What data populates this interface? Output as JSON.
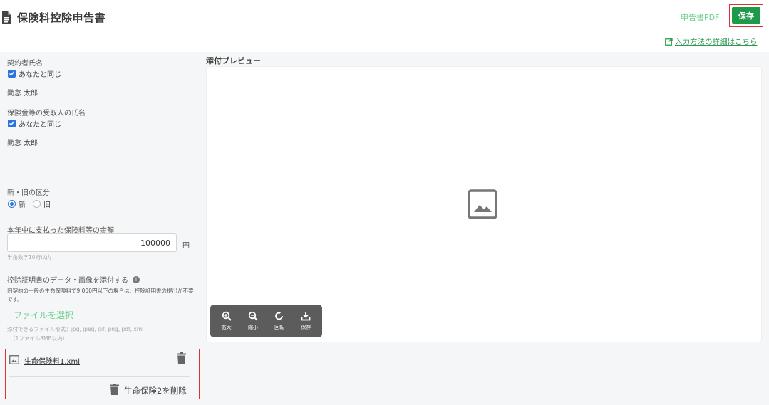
{
  "header": {
    "title": "保険料控除申告書",
    "pdf_label": "申告書PDF",
    "save_label": "保存",
    "detail_link": "入力方法の詳細はこちら"
  },
  "form": {
    "contractor_label": "契約者氏名",
    "contractor_same": "あなたと同じ",
    "contractor_name": "勤怠 太郎",
    "recipient_label": "保険金等の受取人の氏名",
    "recipient_same": "あなたと同じ",
    "recipient_name": "勤怠 太郎",
    "category_label": "新・旧の区分",
    "option_new": "新",
    "option_old": "旧",
    "amount_label": "本年中に支払った保険料等の金額",
    "amount_value": "100000",
    "amount_unit": "円",
    "amount_hint": "半角数字10桁以内",
    "attach_label": "控除証明書のデータ・画像を添付する",
    "attach_note": "旧契約の一般の生命保険料で9,000円以下の場合は、控除証明書の提出が不要です。",
    "file_select": "ファイルを選択",
    "file_types": "添付できるファイル形式：jpg, jpeg, gif, png, pdf, xml",
    "file_size": "（1ファイル8MB以内）",
    "attached_file": "生命保険料1.xml",
    "delete_label": "生命保険2を削除"
  },
  "preview": {
    "title": "添付プレビュー",
    "tools": [
      "拡大",
      "縮小",
      "回転",
      "保存"
    ]
  },
  "colors": {
    "accent_green": "#1e9a4b",
    "link_green": "#6fcf8f",
    "highlight_red": "#e03030",
    "checkbox_blue": "#2b74e0"
  }
}
